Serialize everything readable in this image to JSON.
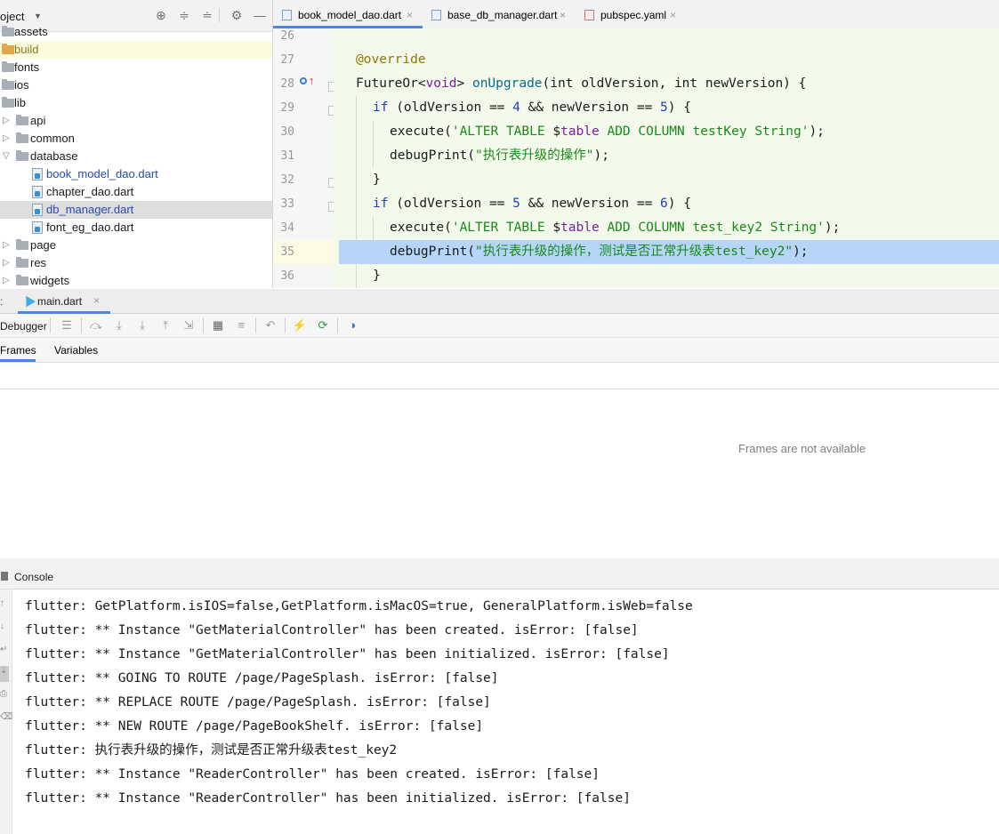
{
  "project": {
    "title": "oject",
    "tree": [
      {
        "label": "assets",
        "type": "folder"
      },
      {
        "label": "build",
        "type": "folder-orange"
      },
      {
        "label": "fonts",
        "type": "folder"
      },
      {
        "label": "ios",
        "type": "folder"
      },
      {
        "label": "lib",
        "type": "folder"
      },
      {
        "label": "api",
        "type": "folder"
      },
      {
        "label": "common",
        "type": "folder"
      },
      {
        "label": "database",
        "type": "folder"
      },
      {
        "label": "book_model_dao.dart",
        "type": "file"
      },
      {
        "label": "chapter_dao.dart",
        "type": "file"
      },
      {
        "label": "db_manager.dart",
        "type": "file"
      },
      {
        "label": "font_eg_dao.dart",
        "type": "file"
      },
      {
        "label": "page",
        "type": "folder"
      },
      {
        "label": "res",
        "type": "folder"
      },
      {
        "label": "widgets",
        "type": "folder"
      }
    ]
  },
  "editor": {
    "tabs": [
      {
        "label": "book_model_dao.dart",
        "active": true
      },
      {
        "label": "base_db_manager.dart",
        "active": false
      },
      {
        "label": "pubspec.yaml",
        "active": false
      }
    ],
    "close_glyph": "×",
    "line_numbers": [
      "26",
      "27",
      "28",
      "29",
      "30",
      "31",
      "32",
      "33",
      "34",
      "35",
      "36"
    ],
    "code": {
      "l27": "@override",
      "l28_a": "FutureOr<",
      "l28_b": "void",
      "l28_c": "> ",
      "l28_d": "onUpgrade",
      "l28_e": "(int oldVersion, int newVersion) {",
      "l29_a": "if",
      "l29_b": " (oldVersion == ",
      "l29_c": "4",
      "l29_d": " && newVersion == ",
      "l29_e": "5",
      "l29_f": ") {",
      "l30_a": "execute(",
      "l30_b": "'ALTER TABLE ",
      "l30_c": "$",
      "l30_d": "table",
      "l30_e": " ADD COLUMN testKey String'",
      "l30_f": ");",
      "l31_a": "debugPrint(",
      "l31_b": "\"执行表升级的操作\"",
      "l31_c": ");",
      "l32": "}",
      "l33_a": "if",
      "l33_b": " (oldVersion == ",
      "l33_c": "5",
      "l33_d": " && newVersion == ",
      "l33_e": "6",
      "l33_f": ") {",
      "l34_a": "execute(",
      "l34_b": "'ALTER TABLE ",
      "l34_c": "$",
      "l34_d": "table",
      "l34_e": " ADD COLUMN test_key2 String'",
      "l34_f": ");",
      "l35_a": "debugPrint(",
      "l35_b": "\"执行表升级的操作，测试是否正常升级表test_key2\"",
      "l35_c": ");",
      "l36": "}"
    }
  },
  "run": {
    "colon": ":",
    "tab_label": "main.dart",
    "close_glyph": "×"
  },
  "debug": {
    "label": "Debugger",
    "tabs": [
      "Frames",
      "Variables"
    ],
    "frames_empty": "Frames are not available"
  },
  "console": {
    "title": "Console",
    "lines": [
      "flutter: GetPlatform.isIOS=false,GetPlatform.isMacOS=true, GeneralPlatform.isWeb=false",
      "flutter: ** Instance \"GetMaterialController\" has been created. isError: [false]",
      "flutter: ** Instance \"GetMaterialController\" has been initialized. isError: [false]",
      "flutter: ** GOING TO ROUTE /page/PageSplash. isError: [false]",
      "flutter: ** REPLACE ROUTE /page/PageSplash. isError: [false]",
      "flutter: ** NEW ROUTE /page/PageBookShelf. isError: [false]",
      "flutter: 执行表升级的操作，测试是否正常升级表test_key2",
      "flutter: ** Instance \"ReaderController\" has been created. isError: [false]",
      "flutter: ** Instance \"ReaderController\" has been initialized. isError: [false]"
    ]
  },
  "colors": {
    "accent": "#4a86e8",
    "editor_bg": "#f4faeb",
    "line_highlight": "#b6d5f8"
  }
}
